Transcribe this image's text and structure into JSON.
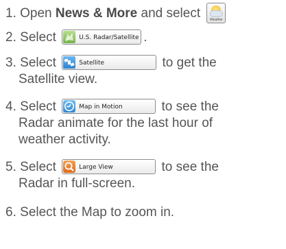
{
  "steps": [
    {
      "number": "1.",
      "pre": "Open",
      "bold": "News & More",
      "post": "and select"
    },
    {
      "number": "2.",
      "pre": "Select",
      "post": "."
    },
    {
      "number": "3.",
      "pre": "Select",
      "post": "to get the",
      "cont": "Satellite view."
    },
    {
      "number": "4.",
      "pre": "Select",
      "post": "to see the",
      "cont1": "Radar animate for the last hour of",
      "cont2": "weather activity."
    },
    {
      "number": "5.",
      "pre": "Select",
      "post": "to see the",
      "cont": "Radar in full-screen."
    },
    {
      "number": "6.",
      "text": "Select the Map to zoom in."
    }
  ],
  "buttons": {
    "weather_icon_label": "Weather",
    "radar_label": "U.S. Radar/Satellite",
    "satellite_label": "Satellite",
    "motion_label": "Map in Motion",
    "large_label": "Large View"
  },
  "colors": {
    "text": "#555555",
    "radar_icon": "#8cc864",
    "satellite_icon": "#3a8fd8",
    "motion_icon": "#3a8fd8",
    "large_icon": "#e87a2a"
  }
}
